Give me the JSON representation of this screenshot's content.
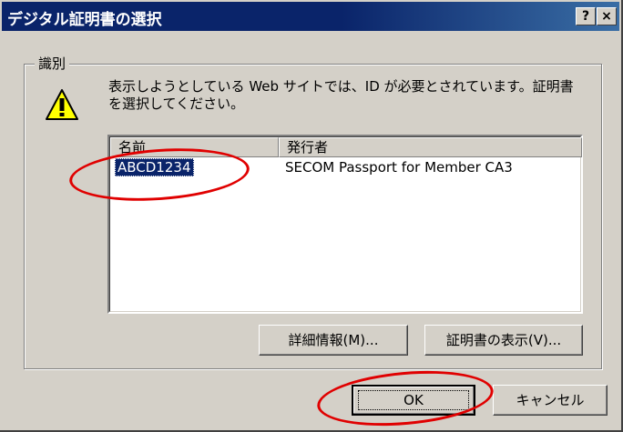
{
  "window": {
    "title": "デジタル証明書の選択",
    "help_label": "?",
    "close_label": "×"
  },
  "group": {
    "legend": "識別",
    "message": "表示しようとしている Web サイトでは、ID が必要とされています。証明書を選択してください。"
  },
  "list": {
    "columns": [
      "名前",
      "発行者"
    ],
    "rows": [
      {
        "name": "ABCD1234",
        "issuer": "SECOM Passport for Member CA3",
        "selected": true
      }
    ]
  },
  "buttons": {
    "details": "詳細情報(M)...",
    "view_cert": "証明書の表示(V)...",
    "ok": "OK",
    "cancel": "キャンセル"
  },
  "colors": {
    "face": "#d4d0c8",
    "title_bar": "#0a246a",
    "selection": "#0a246a",
    "annotation": "#e00000"
  }
}
